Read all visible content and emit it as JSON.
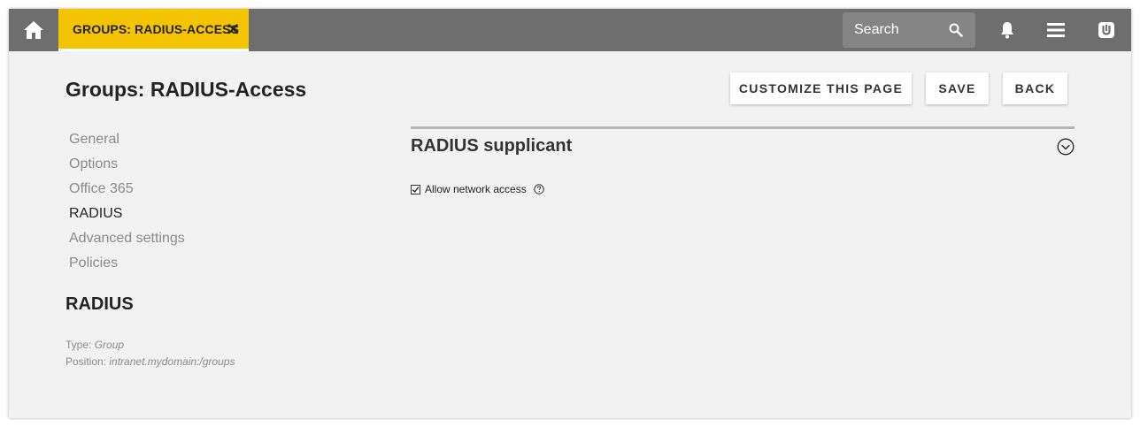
{
  "tab": {
    "label": "GROUPS: RADIUS-ACCESS",
    "close_glyph": "✕"
  },
  "search": {
    "placeholder": "Search"
  },
  "icons": {
    "home": "home-icon",
    "search": "search-icon",
    "notifications": "bell-icon",
    "menu": "menu-icon",
    "account": "user-logo-icon",
    "collapse": "chevron-circle-icon",
    "help": "help-icon"
  },
  "colors": {
    "topbar": "#6e6e6e",
    "tab_accent": "#f5c400",
    "page_background": "#f2f2f2"
  },
  "page": {
    "title": "Groups: RADIUS-Access"
  },
  "toolbar": {
    "customize_label": "CUSTOMIZE THIS PAGE",
    "save_label": "SAVE",
    "back_label": "BACK"
  },
  "nav": {
    "items": [
      {
        "label": "General"
      },
      {
        "label": "Options"
      },
      {
        "label": "Office 365"
      },
      {
        "label": "RADIUS",
        "active": true
      },
      {
        "label": "Advanced settings"
      },
      {
        "label": "Policies"
      }
    ]
  },
  "section": {
    "heading": "RADIUS"
  },
  "meta": {
    "type_label": "Type:",
    "type_value": "Group",
    "position_label": "Position:",
    "position_value": "intranet.mydomain:/groups"
  },
  "panel": {
    "title": "RADIUS supplicant",
    "checkbox_label": "Allow network access",
    "checkbox_checked": true
  }
}
